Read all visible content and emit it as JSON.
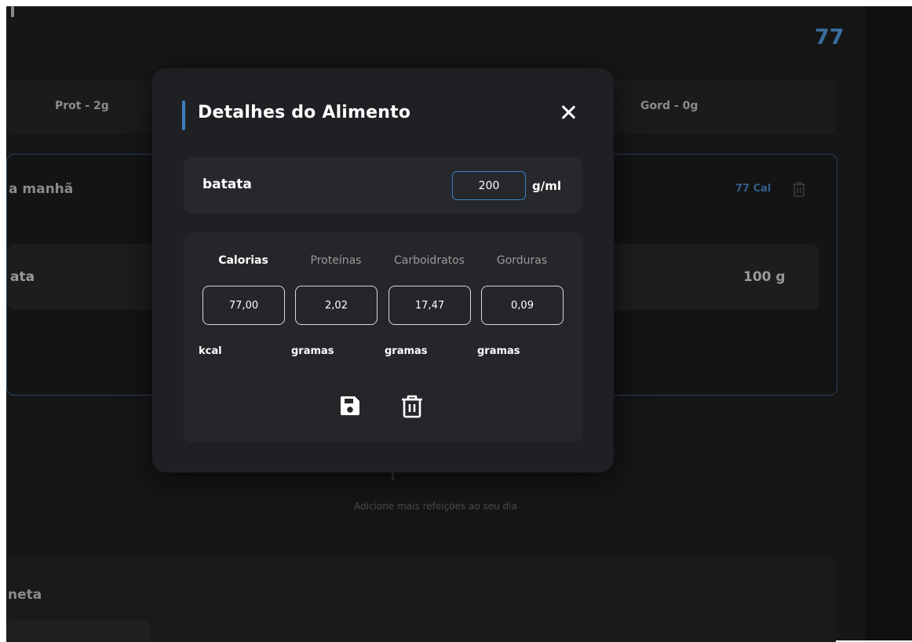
{
  "background": {
    "total_calories": "77",
    "macros": {
      "protein": "Prot - 2g",
      "fat": "Gord - 0g"
    },
    "meal": {
      "title": "a manhã",
      "calories": "77 Cal",
      "food_name": "ata",
      "food_quantity": "100 g"
    },
    "add_hint": "Adicione mais refeições ao seu dia",
    "meal2": {
      "title": "neta"
    }
  },
  "modal": {
    "title": "Detalhes do Alimento",
    "food_name": "batata",
    "quantity_value": "200",
    "quantity_unit": "g/ml",
    "nutrients": [
      {
        "label": "Calorias",
        "value": "77,00",
        "unit": "kcal"
      },
      {
        "label": "Proteínas",
        "value": "2,02",
        "unit": "gramas"
      },
      {
        "label": "Carboidratos",
        "value": "17,47",
        "unit": "gramas"
      },
      {
        "label": "Gorduras",
        "value": "0,09",
        "unit": "gramas"
      }
    ]
  },
  "colors": {
    "accent": "#3d7fc0",
    "modal_bg": "#1e2023",
    "panel_bg": "#26282c"
  },
  "icons": {
    "close": "close-icon",
    "save": "save-icon",
    "delete": "trash-icon"
  }
}
